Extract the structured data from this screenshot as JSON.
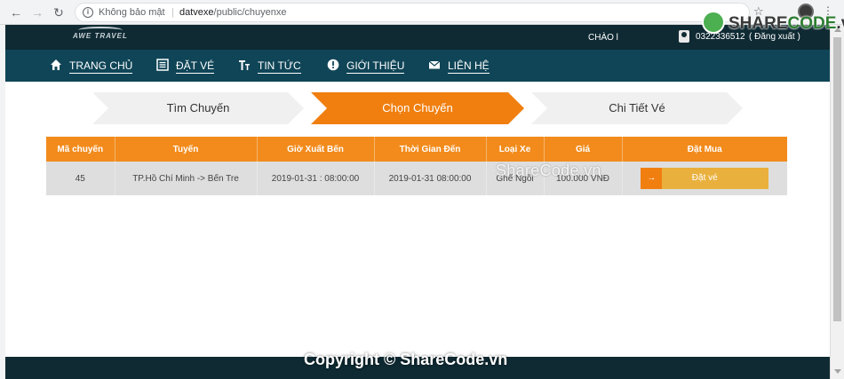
{
  "browser": {
    "security_label": "Không bảo mật",
    "url_host": "datvexe",
    "url_path": "/public/chuyenxe"
  },
  "header": {
    "logo_text": "AWE TRAVEL",
    "greeting": "CHÀO l",
    "phone": "0322336512",
    "logout": "( Đăng xuất )"
  },
  "nav": {
    "home": "TRANG CHỦ",
    "book": "ĐẶT VÉ",
    "news": "TIN TỨC",
    "about": "GIỚI THIỆU",
    "contact": "LIÊN HỆ"
  },
  "steps": [
    {
      "label": "Tìm Chuyến",
      "active": false
    },
    {
      "label": "Chọn Chuyến",
      "active": true
    },
    {
      "label": "Chi Tiết Vé",
      "active": false
    }
  ],
  "table": {
    "headers": [
      "Mã chuyến",
      "Tuyến",
      "Giờ Xuất Bến",
      "Thời Gian Đến",
      "Loại Xe",
      "Giá",
      "Đặt Mua"
    ],
    "rows": [
      {
        "id": "45",
        "route": "TP.Hồ Chí Minh -> Bến Tre",
        "departure": "2019-01-31 : 08:00:00",
        "arrival": "2019-01-31 08:00:00",
        "vehicle": "Ghế Ngồi",
        "price": "100.000 VNĐ",
        "book_label": "Đặt vé"
      }
    ]
  },
  "watermarks": {
    "logo_a": "SHARE",
    "logo_b": "CODE",
    "logo_c": ".vn",
    "center": "ShareCode.vn",
    "footer": "Copyright © ShareCode.vn"
  },
  "colors": {
    "accent": "#f28b1c",
    "header_dark": "#0f2a33",
    "nav_bg": "#0f4557",
    "book_button": "#e9b03d"
  }
}
